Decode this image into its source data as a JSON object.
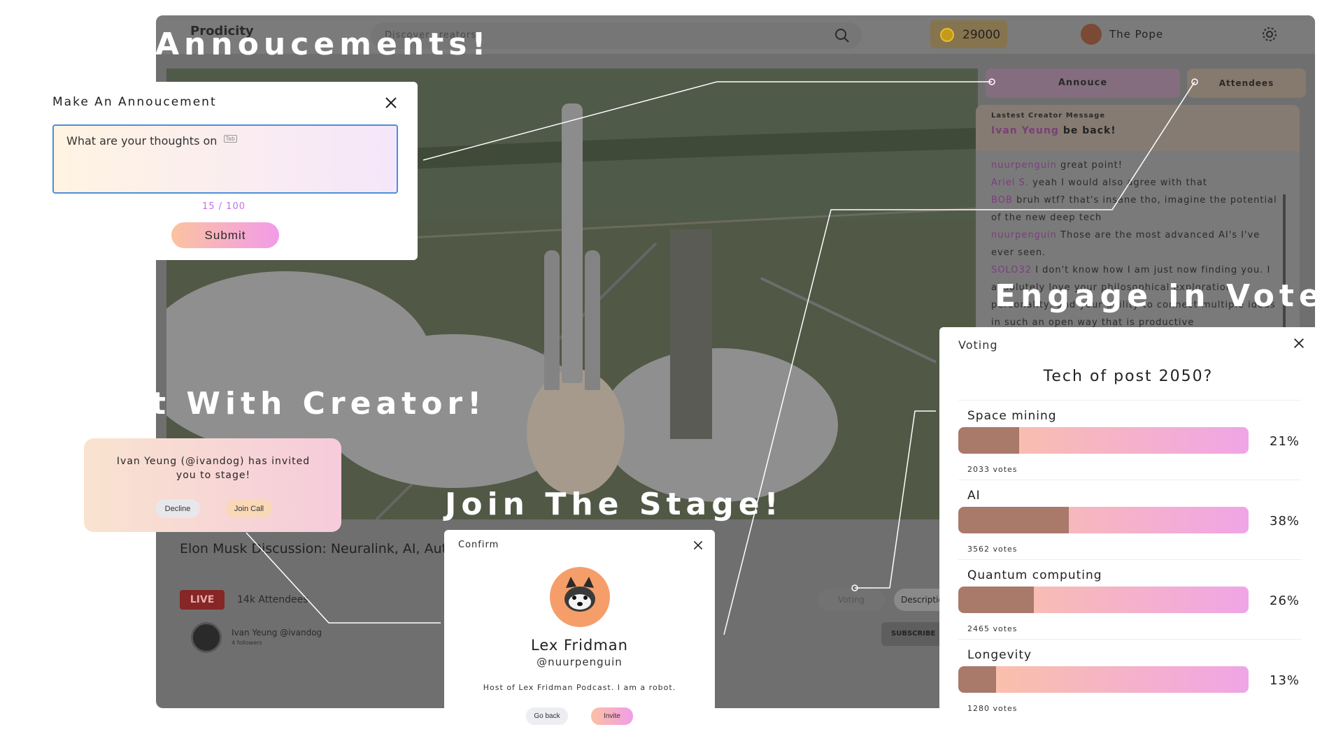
{
  "app": {
    "brand": "Prodicity",
    "search_placeholder": "Discover creators",
    "coins": "29000",
    "user_name": "The Pope"
  },
  "stream": {
    "title": "Elon Musk Discussion: Neuralink, AI, Aut",
    "live": "LIVE",
    "attendees": "14k Attendees",
    "creator_name": "Ivan Yeung @ivandog",
    "creator_followers": "4 followers",
    "tab_voting": "Voting",
    "tab_description": "Description",
    "subscribe": "SUBSCRIBE"
  },
  "side_tabs": {
    "announce": "Annouce",
    "attendees": "Attendees"
  },
  "chat": {
    "latest_label": "Lastest Creator Message",
    "latest_user": "Ivan Yeung",
    "latest_text": "be back!",
    "messages": [
      {
        "user": "nuurpenguin",
        "text": "great point!"
      },
      {
        "user": "Ariel S.",
        "text": "yeah I would also agree with that"
      },
      {
        "user": "BOB",
        "text": "bruh wtf? that's insane tho, imagine the potential of the new deep tech"
      },
      {
        "user": "nuurpenguin",
        "text": "Those are the most advanced AI's I've ever seen."
      },
      {
        "user": "SOLO32",
        "text": "I don't know how I am just now finding you. I absolutely love your philosophical exploration, personality, and your ability to connect multiple ideas in such an open way that is productive"
      }
    ]
  },
  "headlines": {
    "announcements": "Annoucements!",
    "chat": "t With Creator!",
    "stage": "Join The Stage!",
    "votes": "Engage in Votes!"
  },
  "announce_modal": {
    "title": "Make An Annoucement",
    "value": "What are your thoughts on",
    "tab_hint": "Tab",
    "counter": "15 / 100",
    "submit": "Submit"
  },
  "invite": {
    "text": "Ivan Yeung (@ivandog) has invited you to stage!",
    "decline": "Decline",
    "join": "Join Call"
  },
  "confirm": {
    "title": "Confirm",
    "name": "Lex Fridman",
    "handle": "@nuurpenguin",
    "bio": "Host of Lex Fridman Podcast. I am a robot.",
    "back": "Go back",
    "invite": "Invite"
  },
  "voting": {
    "label": "Voting",
    "question": "Tech of post 2050?",
    "options": [
      {
        "name": "Space mining",
        "percent": "21%",
        "share": 0.21,
        "votes": "2033 votes"
      },
      {
        "name": "AI",
        "percent": "38%",
        "share": 0.38,
        "votes": "3562 votes"
      },
      {
        "name": "Quantum computing",
        "percent": "26%",
        "share": 0.26,
        "votes": "2465 votes"
      },
      {
        "name": "Longevity",
        "percent": "13%",
        "share": 0.13,
        "votes": "1280 votes"
      }
    ]
  },
  "colors": {
    "accent_pink": "#f29be9",
    "accent_peach": "#fbc3a0",
    "username_purple": "#7a3e7d",
    "live_red": "#862626"
  }
}
